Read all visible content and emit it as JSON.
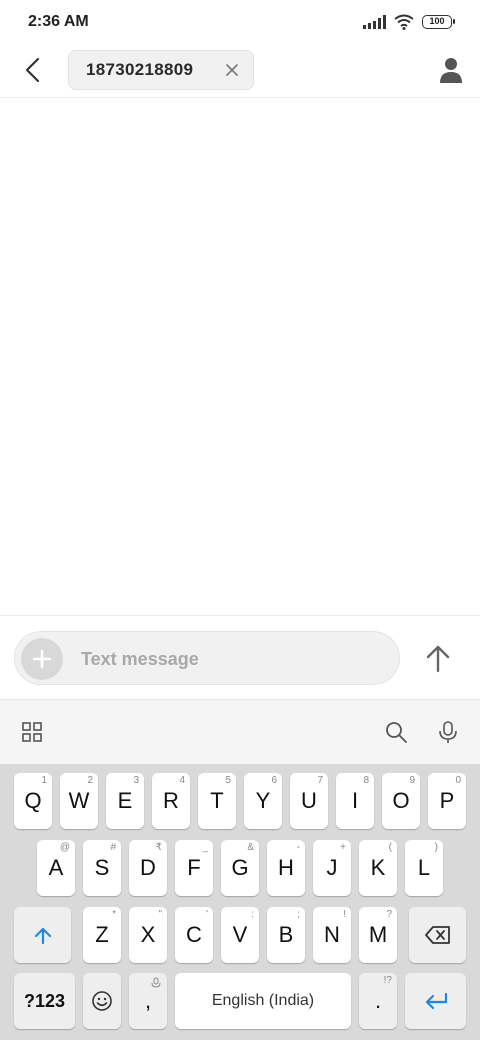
{
  "status_bar": {
    "time": "2:36 AM",
    "battery": "100"
  },
  "header": {
    "recipient": "18730218809"
  },
  "composer": {
    "placeholder": "Text message"
  },
  "keyboard": {
    "row1": [
      {
        "label": "Q",
        "hint": "1"
      },
      {
        "label": "W",
        "hint": "2"
      },
      {
        "label": "E",
        "hint": "3"
      },
      {
        "label": "R",
        "hint": "4"
      },
      {
        "label": "T",
        "hint": "5"
      },
      {
        "label": "Y",
        "hint": "6"
      },
      {
        "label": "U",
        "hint": "7"
      },
      {
        "label": "I",
        "hint": "8"
      },
      {
        "label": "O",
        "hint": "9"
      },
      {
        "label": "P",
        "hint": "0"
      }
    ],
    "row2": [
      {
        "label": "A",
        "hint": "@"
      },
      {
        "label": "S",
        "hint": "#"
      },
      {
        "label": "D",
        "hint": "₹"
      },
      {
        "label": "F",
        "hint": "_"
      },
      {
        "label": "G",
        "hint": "&"
      },
      {
        "label": "H",
        "hint": "-"
      },
      {
        "label": "J",
        "hint": "+"
      },
      {
        "label": "K",
        "hint": "("
      },
      {
        "label": "L",
        "hint": ")"
      }
    ],
    "row3": [
      {
        "label": "Z",
        "hint": "*"
      },
      {
        "label": "X",
        "hint": "\""
      },
      {
        "label": "C",
        "hint": "'"
      },
      {
        "label": "V",
        "hint": ":"
      },
      {
        "label": "B",
        "hint": ";"
      },
      {
        "label": "N",
        "hint": "!"
      },
      {
        "label": "M",
        "hint": "?"
      }
    ],
    "symbols_label": "?123",
    "comma_label": ",",
    "space_label": "English (India)",
    "period_label": ".",
    "period_hint": "!?"
  },
  "colors": {
    "accent": "#1e88e5",
    "keyboard_bg": "#d9d9d9",
    "key_bg": "#ffffff"
  }
}
